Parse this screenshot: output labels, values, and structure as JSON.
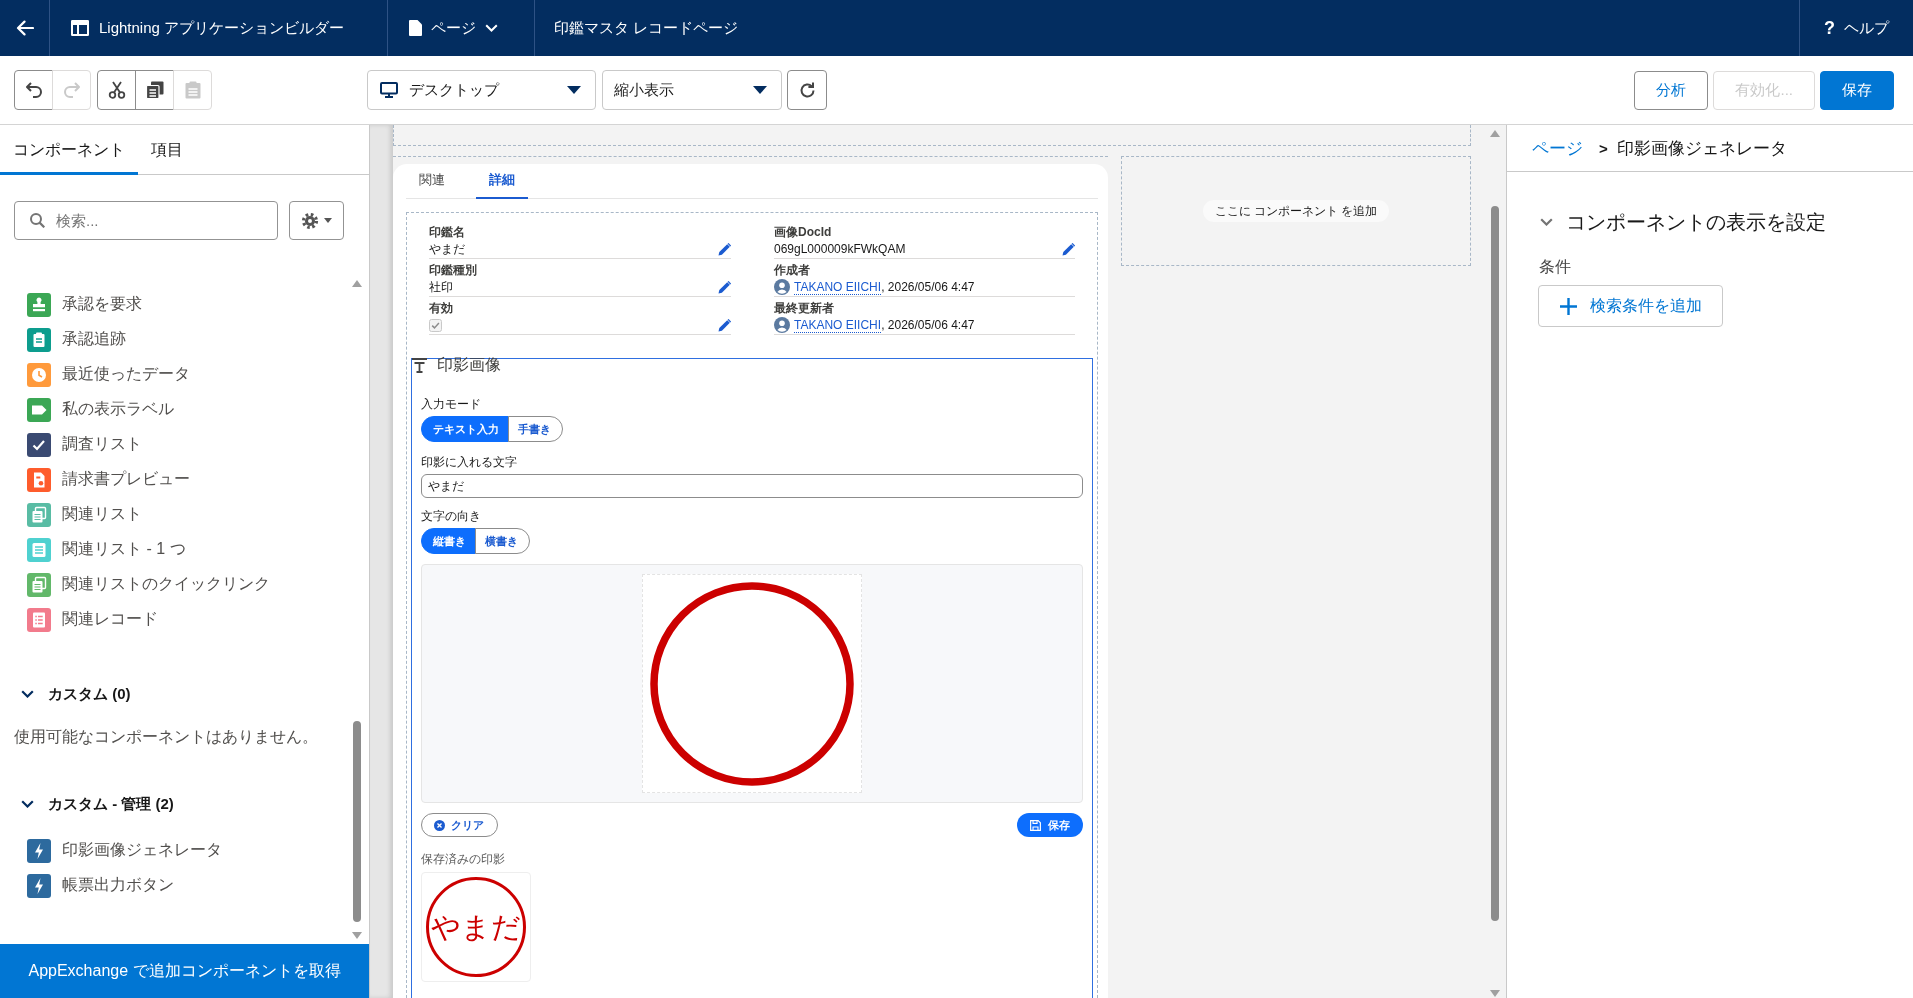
{
  "top_bar": {
    "app_name": "Lightning アプリケーションビルダー",
    "page_menu": "ページ",
    "page_title": "印鑑マスタ レコードページ",
    "help": {
      "mark": "?",
      "label": "ヘルプ"
    }
  },
  "toolbar": {
    "history_buttons": [
      {
        "kind": "undo",
        "disabled": false
      },
      {
        "kind": "redo",
        "disabled": true
      }
    ],
    "clipboard_buttons": [
      {
        "kind": "cut",
        "disabled": false
      },
      {
        "kind": "copy",
        "disabled": false
      },
      {
        "kind": "paste",
        "disabled": true
      }
    ],
    "device_select": "デスクトップ",
    "zoom_select": "縮小表示",
    "actions": [
      {
        "label": "分析",
        "kind": "neutral",
        "disabled": false
      },
      {
        "label": "有効化...",
        "kind": "neutral",
        "disabled": true
      },
      {
        "label": "保存",
        "kind": "brand",
        "disabled": false
      }
    ]
  },
  "left_panel": {
    "tabs": [
      {
        "label": "コンポーネント",
        "selected": true
      },
      {
        "label": "項目",
        "selected": false
      }
    ],
    "search": {
      "placeholder": "検索..."
    },
    "components": [
      {
        "label": "承認を要求",
        "kind": "stamp",
        "color": "#3ba755"
      },
      {
        "label": "承認追跡",
        "kind": "clipboard",
        "color": "#0d9d8e"
      },
      {
        "label": "最近使ったデータ",
        "kind": "clock",
        "color": "#ff9a3c"
      },
      {
        "label": "私の表示ラベル",
        "kind": "tag",
        "color": "#3ba755"
      },
      {
        "label": "調査リスト",
        "kind": "check",
        "color": "#3a4a72"
      },
      {
        "label": "請求書プレビュー",
        "kind": "invoice",
        "color": "#fe5c2c"
      },
      {
        "label": "関連リスト",
        "kind": "stack",
        "color": "#59bca4"
      },
      {
        "label": "関連リスト - 1 つ",
        "kind": "lines",
        "color": "#4fd1d0"
      },
      {
        "label": "関連リストのクイックリンク",
        "kind": "stack",
        "color": "#62b86a"
      },
      {
        "label": "関連レコード",
        "kind": "list",
        "color": "#f27b8c"
      }
    ],
    "sections": [
      {
        "title": "カスタム (0)",
        "expanded": true,
        "empty_text": "使用可能なコンポーネントはありません。"
      },
      {
        "title": "カスタム - 管理 (2)",
        "expanded": true,
        "items": [
          {
            "label": "印影画像ジェネレータ",
            "kind": "bolt"
          },
          {
            "label": "帳票出力ボタン",
            "kind": "bolt"
          }
        ]
      }
    ],
    "footer_link": "AppExchange で追加コンポーネントを取得"
  },
  "canvas": {
    "record_tabs": [
      {
        "label": "関連",
        "selected": false
      },
      {
        "label": "詳細",
        "selected": true
      }
    ],
    "fields": [
      {
        "label": "印鑑名",
        "kind": "text",
        "value": "やまだ",
        "editable": true
      },
      {
        "label": "画像DocId",
        "kind": "text",
        "value": "069gL000009kFWkQAM",
        "editable": true
      },
      {
        "label": "印鑑種別",
        "kind": "text",
        "value": "社印",
        "editable": true
      },
      {
        "label": "作成者",
        "kind": "user",
        "user": "TAKANO EIICHI",
        "date_text": ", 2026/05/06 4:47",
        "editable": false
      },
      {
        "label": "有効",
        "kind": "checkbox",
        "checked": true,
        "editable": true
      },
      {
        "label": "最終更新者",
        "kind": "user",
        "user": "TAKANO EIICHI",
        "date_text": ", 2026/05/06 4:47",
        "editable": false
      }
    ],
    "stamp_component": {
      "title": "印影画像",
      "input_mode": {
        "label": "入力モード",
        "options": [
          {
            "label": "テキスト入力",
            "selected": true
          },
          {
            "label": "手書き",
            "selected": false
          }
        ]
      },
      "stamp_text": {
        "label": "印影に入れる文字",
        "value": "やまだ"
      },
      "direction": {
        "label": "文字の向き",
        "options": [
          {
            "label": "縦書き",
            "selected": true
          },
          {
            "label": "横書き",
            "selected": false
          }
        ]
      },
      "clear_button": "クリア",
      "save_button": "保存",
      "saved_label": "保存済みの印影",
      "saved_stamps": [
        {
          "text": "やまだ"
        }
      ]
    },
    "drop_zone": "ここに コンポーネント を追加"
  },
  "right_panel": {
    "breadcrumb": {
      "items": [
        {
          "label": "ページ",
          "kind": "link"
        },
        {
          "label": "印影画像ジェネレータ",
          "kind": "current"
        }
      ],
      "separator": ">"
    },
    "visibility_section": {
      "title": "コンポーネントの表示を設定",
      "expanded": true,
      "conditions_label": "条件",
      "add_button": "検索条件を追加"
    }
  }
}
